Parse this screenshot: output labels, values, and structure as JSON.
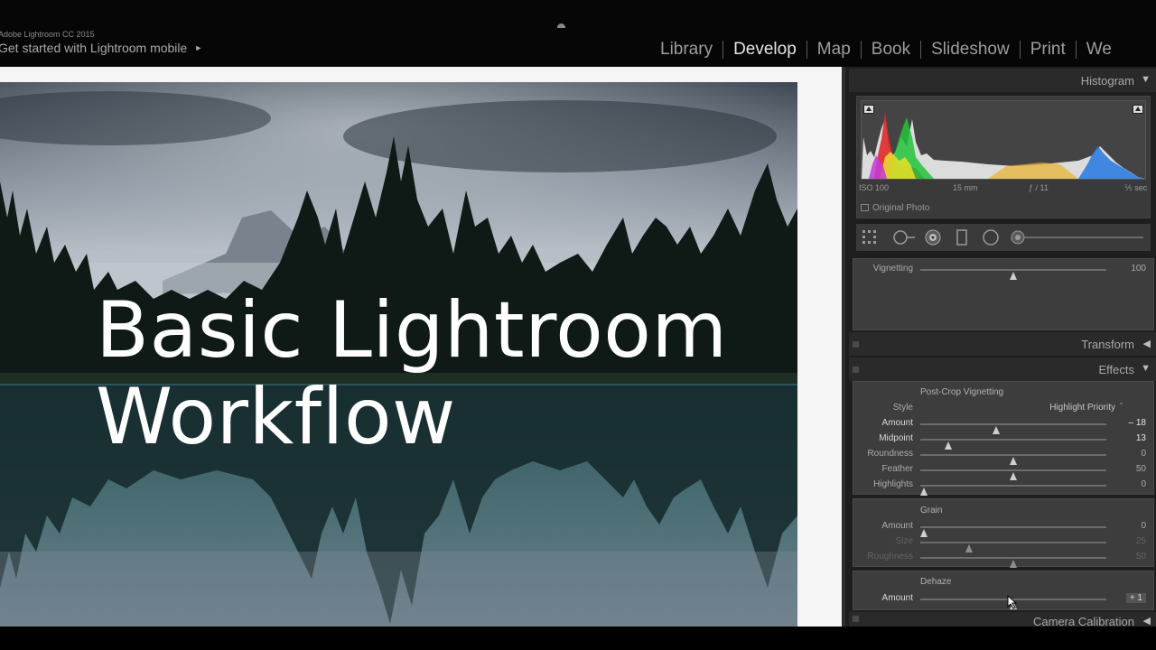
{
  "app": {
    "name": "Adobe Lightroom CC 2015",
    "mobile_link": "Get started with Lightroom mobile",
    "mobile_arrow": "►"
  },
  "modules": [
    {
      "label": "Library",
      "active": false
    },
    {
      "label": "Develop",
      "active": true
    },
    {
      "label": "Map",
      "active": false
    },
    {
      "label": "Book",
      "active": false
    },
    {
      "label": "Slideshow",
      "active": false
    },
    {
      "label": "Print",
      "active": false
    },
    {
      "label": "We",
      "active": false
    }
  ],
  "overlay": {
    "line1": "Basic Lightroom",
    "line2": "Workflow"
  },
  "histogram": {
    "title": "Histogram",
    "toggle": "▼",
    "exif": {
      "iso": "ISO 100",
      "focal": "15 mm",
      "aperture": "ƒ / 11",
      "shutter": "⅕ sec"
    },
    "original_photo": "Original Photo"
  },
  "tools": [
    "crop-overlay",
    "spot-removal",
    "red-eye",
    "graduated-filter",
    "radial-filter",
    "adjustment-brush"
  ],
  "vignetting_row": {
    "label": "Vignetting",
    "value": "100",
    "level": 0.5
  },
  "transform": {
    "title": "Transform",
    "toggle": "◀"
  },
  "effects": {
    "title": "Effects",
    "toggle": "▼",
    "post_crop": {
      "title": "Post-Crop Vignetting",
      "style_label": "Style",
      "style_value": "Highlight Priority",
      "style_caret": "⌃",
      "rows": [
        {
          "label": "Amount",
          "value": "– 18",
          "level": 0.41
        },
        {
          "label": "Midpoint",
          "value": "13",
          "level": 0.15
        },
        {
          "label": "Roundness",
          "value": "0",
          "level": 0.5
        },
        {
          "label": "Feather",
          "value": "50",
          "level": 0.5
        },
        {
          "label": "Highlights",
          "value": "0",
          "level": 0.02
        }
      ]
    },
    "grain": {
      "title": "Grain",
      "rows": [
        {
          "label": "Amount",
          "value": "0",
          "level": 0.02
        },
        {
          "label": "Size",
          "value": "25",
          "level": 0.26
        },
        {
          "label": "Roughness",
          "value": "50",
          "level": 0.5
        }
      ]
    },
    "dehaze": {
      "title": "Dehaze",
      "row": {
        "label": "Amount",
        "value": "+ 1",
        "level": 0.5
      }
    }
  },
  "camera_calibration": {
    "title": "Camera Calibration",
    "toggle": "◀"
  },
  "colors": {
    "panel_bg": "#1e1e1e",
    "section_bg": "#3d3d3d",
    "active_module": "#e6e6e6",
    "inactive_module": "#9e9e9e"
  }
}
